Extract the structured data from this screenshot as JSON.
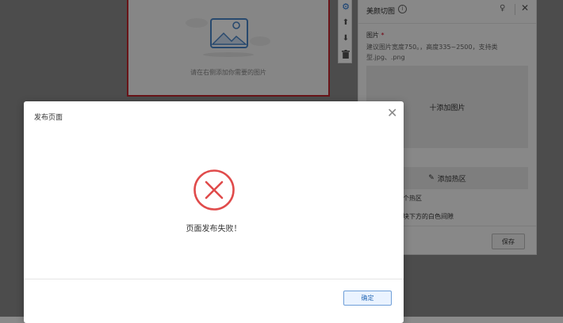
{
  "canvas": {
    "hint": "请在右侧添加你需要的图片"
  },
  "tools": {
    "settings_icon": "gear-icon",
    "up_icon": "arrow-up-icon",
    "down_icon": "arrow-down-icon",
    "delete_icon": "trash-icon"
  },
  "panel": {
    "title": "美颜切图",
    "info_icon": "ⓘ",
    "bulb_icon": "💡",
    "close_icon": "✕",
    "image_label": "图片",
    "required_mark": "*",
    "image_hint": "建议图片宽度750。，高度335~2500，支持类型.jpg、.png",
    "upload_label": "十添加图片",
    "hotzone_label": "添加热区",
    "hotzone_count": "个热区",
    "gap_label": "块下方的白色间隙",
    "save_label": "保存"
  },
  "modal": {
    "title": "发布页面",
    "close_icon": "✕",
    "message": "页面发布失败！",
    "ok_label": "确定"
  },
  "colors": {
    "error": "#e04b4b",
    "selected_border": "#c0262d",
    "primary_border": "#6f9fd8"
  }
}
